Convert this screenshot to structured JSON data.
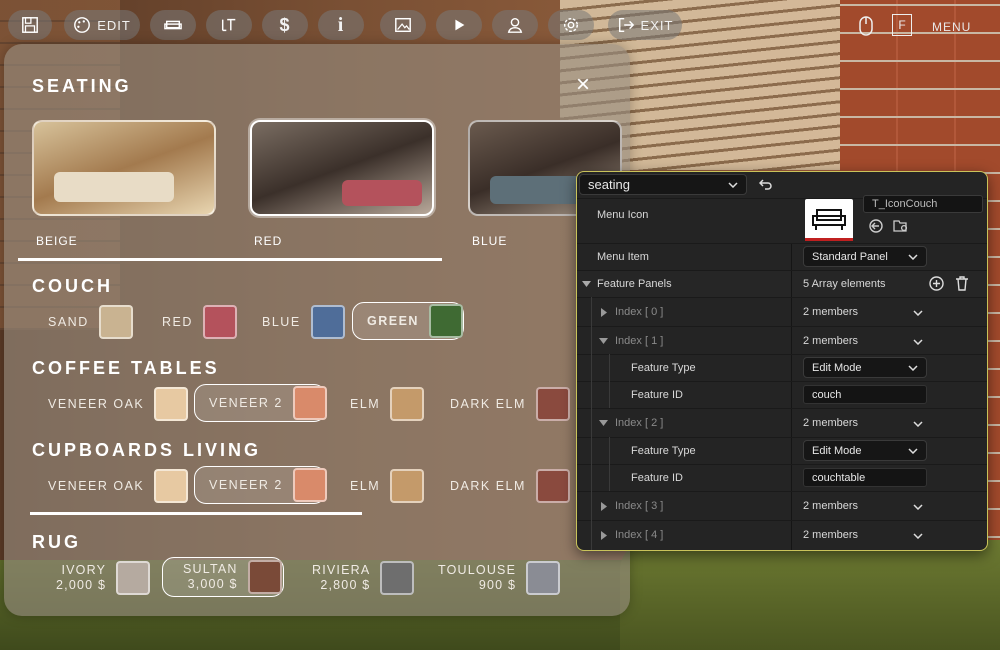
{
  "toolbar": {
    "buttons": [
      {
        "name": "save",
        "label": ""
      },
      {
        "name": "edit",
        "label": "EDIT"
      },
      {
        "name": "furniture",
        "label": ""
      },
      {
        "name": "height",
        "label": ""
      },
      {
        "name": "price",
        "label": ""
      },
      {
        "name": "info",
        "label": ""
      },
      {
        "name": "gallery",
        "label": ""
      },
      {
        "name": "play",
        "label": ""
      },
      {
        "name": "user",
        "label": ""
      },
      {
        "name": "settings",
        "label": ""
      },
      {
        "name": "exit",
        "label": "EXIT"
      }
    ],
    "key_label": "F",
    "menu_label": "MENU"
  },
  "panel": {
    "title": "SEATING",
    "presets": [
      {
        "label": "BEIGE",
        "selected": false
      },
      {
        "label": "RED",
        "selected": true
      },
      {
        "label": "BLUE",
        "selected": false
      }
    ],
    "sections": [
      {
        "title": "COUCH",
        "options": [
          {
            "label": "SAND",
            "color": "#c9b391",
            "selected": false
          },
          {
            "label": "RED",
            "color": "#b4525c",
            "selected": false
          },
          {
            "label": "BLUE",
            "color": "#4f6d99",
            "selected": false
          },
          {
            "label": "GREEN",
            "color": "#3f6a33",
            "selected": true
          }
        ]
      },
      {
        "title": "COFFEE TABLES",
        "options": [
          {
            "label": "VENEER OAK",
            "color": "#e7c9a2",
            "selected": false
          },
          {
            "label": "VENEER 2",
            "color": "#d98a6a",
            "selected": true
          },
          {
            "label": "ELM",
            "color": "#c49a6a",
            "selected": false
          },
          {
            "label": "DARK ELM",
            "color": "#8a4a3e",
            "selected": false
          }
        ]
      },
      {
        "title": "CUPBOARDS LIVING",
        "options": [
          {
            "label": "VENEER OAK",
            "color": "#e7c9a2",
            "selected": false
          },
          {
            "label": "VENEER 2",
            "color": "#d98a6a",
            "selected": true
          },
          {
            "label": "ELM",
            "color": "#c49a6a",
            "selected": false
          },
          {
            "label": "DARK ELM",
            "color": "#8a4a3e",
            "selected": false
          }
        ]
      }
    ],
    "rug": {
      "title": "RUG",
      "options": [
        {
          "name": "IVORY",
          "price": "2,000 $",
          "color": "#b5aaa0",
          "selected": false
        },
        {
          "name": "SULTAN",
          "price": "3,000 $",
          "color": "#7a4a38",
          "selected": true
        },
        {
          "name": "RIVIERA",
          "price": "2,800 $",
          "color": "#6e6e6e",
          "selected": false
        },
        {
          "name": "TOULOUSE",
          "price": "900 $",
          "color": "#8a8c94",
          "selected": false
        }
      ]
    }
  },
  "editor": {
    "asset_dropdown": "seating",
    "rows": {
      "menu_icon": {
        "label": "Menu Icon",
        "texture": "T_IconCouch"
      },
      "menu_item": {
        "label": "Menu Item",
        "value": "Standard Panel"
      },
      "feature_panels": {
        "label": "Feature Panels",
        "value": "5 Array elements"
      },
      "index0": {
        "label": "Index [ 0 ]",
        "value": "2 members"
      },
      "index1": {
        "label": "Index [ 1 ]",
        "value": "2 members"
      },
      "index1_type": {
        "label": "Feature Type",
        "value": "Edit Mode"
      },
      "index1_id": {
        "label": "Feature ID",
        "value": "couch"
      },
      "index2": {
        "label": "Index [ 2 ]",
        "value": "2 members"
      },
      "index2_type": {
        "label": "Feature Type",
        "value": "Edit Mode"
      },
      "index2_id": {
        "label": "Feature ID",
        "value": "couchtable"
      },
      "index3": {
        "label": "Index [ 3 ]",
        "value": "2 members"
      },
      "index4": {
        "label": "Index [ 4 ]",
        "value": "2 members"
      }
    }
  }
}
